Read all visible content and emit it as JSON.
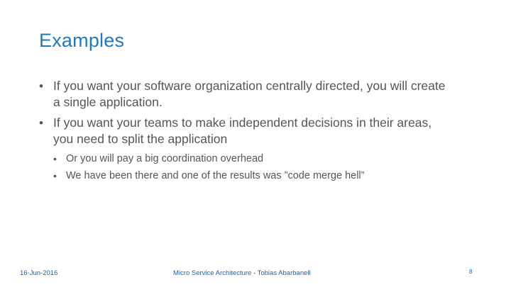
{
  "slide": {
    "title": "Examples",
    "bullets": [
      {
        "text": "If you want your software organization centrally directed, you will create a single application."
      },
      {
        "text": "If you want your teams to make independent decisions in their areas, you need to split the application",
        "sub_bullets": [
          "Or you will pay a big coordination overhead",
          "We have been there and one of the results was ”code merge hell”"
        ]
      }
    ],
    "bullet_glyph": "•"
  },
  "footer": {
    "date": "16-Jun-2016",
    "center": "Micro Service Architecture - Tobias Abarbanell",
    "page_number": "8"
  },
  "colors": {
    "title": "#1f7ab8",
    "body_text": "#555555",
    "footer_text": "#1f5fa8"
  }
}
